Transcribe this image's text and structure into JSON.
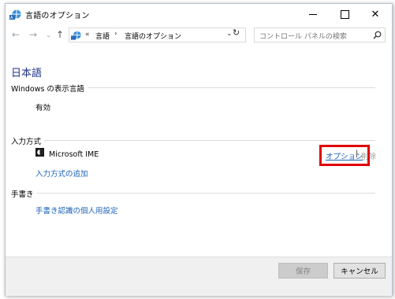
{
  "window": {
    "title": "言語のオプション",
    "icon": "language-globe-icon",
    "controls": [
      "minimize-icon",
      "maximize-icon",
      "close-icon"
    ],
    "close_glyph": "✕"
  },
  "address_bar": {
    "back_glyph": "←",
    "forward_glyph": "→",
    "recent_glyph": "⌄",
    "up_glyph": "↑",
    "overflow_glyph": "«",
    "path": [
      "言語",
      "言語のオプション"
    ],
    "path_separator": "›",
    "dropdown_glyph": "⌄",
    "refresh_glyph": "↻",
    "search_placeholder": "コントロール パネルの検索"
  },
  "content": {
    "heading": "日本語",
    "display_language": {
      "group_label": "Windows の表示言語",
      "status": "有効"
    },
    "input_method": {
      "group_label": "入力方式",
      "ime_name": "Microsoft IME",
      "options_link": "オプション",
      "separator": "|",
      "remove_link": "削除",
      "add_link": "入力方式の追加"
    },
    "handwriting": {
      "group_label": "手書き",
      "personalize_link": "手書き認識の個人用設定"
    }
  },
  "footer": {
    "save_label": "保存",
    "cancel_label": "キャンセル"
  },
  "colors": {
    "heading": "#1e3287",
    "link": "#1c62b9",
    "highlight": "#e00000",
    "footer_bg": "#f0f0f0"
  }
}
